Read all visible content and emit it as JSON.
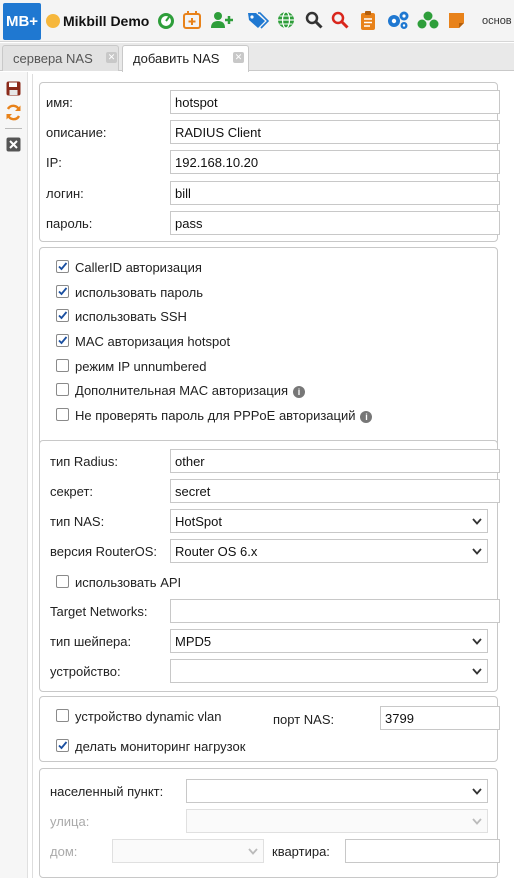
{
  "header": {
    "logo": "MB+",
    "app_name": "Mikbill Demo",
    "right_label": "основ",
    "icons": [
      {
        "name": "dashboard-icon",
        "color": "#2e9e3a"
      },
      {
        "name": "calendar-add-icon",
        "color": "#e8821a"
      },
      {
        "name": "user-add-icon",
        "color": "#2e9e3a"
      },
      {
        "name": "tags-icon",
        "color": "#1f78d1"
      },
      {
        "name": "globe-icon",
        "color": "#2e9e3a"
      },
      {
        "name": "search-icon",
        "color": "#333333"
      },
      {
        "name": "search-red-icon",
        "color": "#d9261c"
      },
      {
        "name": "clipboard-icon",
        "color": "#e8821a"
      },
      {
        "name": "cogs-icon",
        "color": "#1f78d1"
      },
      {
        "name": "network-icon",
        "color": "#2e9e3a"
      },
      {
        "name": "note-icon",
        "color": "#e8821a"
      }
    ]
  },
  "tabs": [
    {
      "label": "сервера NAS",
      "active": false
    },
    {
      "label": "добавить NAS",
      "active": true
    }
  ],
  "toolbar": {
    "save": "save-icon",
    "refresh": "refresh-icon",
    "close": "close-icon"
  },
  "credentials": {
    "name_label": "имя:",
    "name_value": "hotspot",
    "desc_label": "описание:",
    "desc_value": "RADIUS Client",
    "ip_label": "IP:",
    "ip_value": "192.168.10.20",
    "login_label": "логин:",
    "login_value": "bill",
    "password_label": "пароль:",
    "password_value": "pass"
  },
  "options": [
    {
      "label": "CallerID авторизация",
      "checked": true,
      "info": false
    },
    {
      "label": "использовать пароль",
      "checked": true,
      "info": false
    },
    {
      "label": "использовать SSH",
      "checked": true,
      "info": false
    },
    {
      "label": "MAC авторизация hotspot",
      "checked": true,
      "info": false
    },
    {
      "label": "режим IP unnumbered",
      "checked": false,
      "info": false
    },
    {
      "label": "Дополнительная MAC авторизация",
      "checked": false,
      "info": true
    },
    {
      "label": "Не проверять пароль для PPPoE авторизаций",
      "checked": false,
      "info": true
    }
  ],
  "radius": {
    "type_label": "тип Radius:",
    "type_value": "other",
    "secret_label": "секрет:",
    "secret_value": "secret",
    "nas_type_label": "тип NAS:",
    "nas_type_value": "HotSpot",
    "ros_label": "версия RouterOS:",
    "ros_value": "Router OS 6.x",
    "api_label": "использовать API",
    "api_checked": false,
    "targets_label": "Target Networks:",
    "targets_value": "",
    "shaper_label": "тип шейпера:",
    "shaper_value": "MPD5",
    "device_label": "устройство:",
    "device_value": ""
  },
  "vlan": {
    "dynvlan_label": "устройство dynamic vlan",
    "dynvlan_checked": false,
    "port_label": "порт NAS:",
    "port_value": "3799",
    "monitor_label": "делать мониторинг нагрузок",
    "monitor_checked": true
  },
  "address": {
    "city_label": "населенный пункт:",
    "city_value": "",
    "street_label": "улица:",
    "street_value": "",
    "house_label": "дом:",
    "house_value": "",
    "apt_label": "квартира:",
    "apt_value": ""
  }
}
